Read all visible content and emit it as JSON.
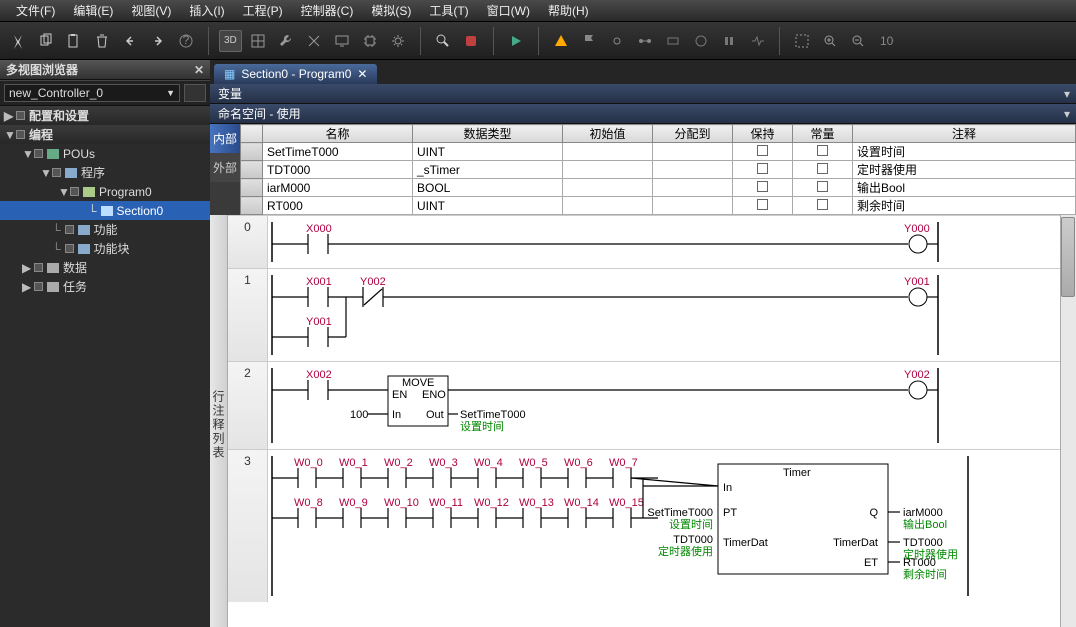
{
  "menu": [
    "文件(F)",
    "编辑(E)",
    "视图(V)",
    "插入(I)",
    "工程(P)",
    "控制器(C)",
    "模拟(S)",
    "工具(T)",
    "窗口(W)",
    "帮助(H)"
  ],
  "leftPanel": {
    "title": "多视图浏览器",
    "controllerCombo": "new_Controller_0",
    "tree": {
      "root1": "配置和设置",
      "root2": "编程",
      "pous": "POUs",
      "programs": "程序",
      "program0": "Program0",
      "section0": "Section0",
      "func": "功能",
      "funcblock": "功能块",
      "data": "数据",
      "task": "任务"
    }
  },
  "tab": {
    "label": "Section0 - Program0"
  },
  "subheaders": {
    "vars": "变量",
    "namespace": "命名空间 - 使用"
  },
  "sideTabs": {
    "internal": "内部",
    "external": "外部"
  },
  "varTable": {
    "headers": [
      "",
      "名称",
      "数据类型",
      "初始值",
      "分配到",
      "保持",
      "常量",
      "注释"
    ],
    "rows": [
      {
        "name": "SetTimeT000",
        "type": "UINT",
        "init": "",
        "alloc": "",
        "comment": "设置时间"
      },
      {
        "name": "TDT000",
        "type": "_sTimer",
        "init": "",
        "alloc": "",
        "comment": "定时器使用"
      },
      {
        "name": "iarM000",
        "type": "BOOL",
        "init": "",
        "alloc": "",
        "comment": "输出Bool"
      },
      {
        "name": "RT000",
        "type": "UINT",
        "init": "",
        "alloc": "",
        "comment": "剩余时间"
      }
    ]
  },
  "ladderSideLabel": "行注释列表",
  "rungs": {
    "r0": {
      "in": "X000",
      "out": "Y000"
    },
    "r1": {
      "c1": "X001",
      "c2": "Y002",
      "c3": "Y001",
      "out": "Y001"
    },
    "r2": {
      "in": "X002",
      "fb": "MOVE",
      "en": "EN",
      "eno": "ENO",
      "inp": "In",
      "outp": "Out",
      "const": "100",
      "outvar": "SetTimeT000",
      "outcmt": "设置时间",
      "coil": "Y002"
    },
    "r3": {
      "row1": [
        "W0_0",
        "W0_1",
        "W0_2",
        "W0_3",
        "W0_4",
        "W0_5",
        "W0_6",
        "W0_7"
      ],
      "row2": [
        "W0_8",
        "W0_9",
        "W0_10",
        "W0_11",
        "W0_12",
        "W0_13",
        "W0_14",
        "W0_15"
      ],
      "fb": "Timer",
      "in": "In",
      "pt": "PT",
      "td": "TimerDat",
      "q": "Q",
      "tdout": "TimerDat",
      "et": "ET",
      "ptin": "SetTimeT000",
      "ptcmt": "设置时间",
      "tdin": "TDT000",
      "tdcmt": "定时器使用",
      "qout": "iarM000",
      "qcmt": "输出Bool",
      "tdoutv": "TDT000",
      "tdoutcmt": "定时器使用",
      "etout": "RT000",
      "etcmt": "剩余时间"
    }
  }
}
